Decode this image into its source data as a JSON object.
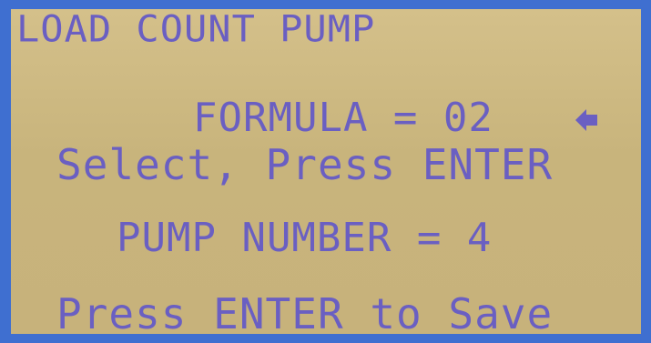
{
  "display": {
    "title": "LOAD COUNT PUMP",
    "formula_line": "FORMULA = 02",
    "select_prompt": "Select, Press ENTER",
    "pump_line": "PUMP NUMBER = 4",
    "save_prompt": "Press ENTER to Save",
    "selection_icon": "diamond-arrow-left-icon",
    "text_color": "#6a5fc2",
    "screen_color": "#cdb982",
    "bezel_color": "#3f6fd0"
  }
}
